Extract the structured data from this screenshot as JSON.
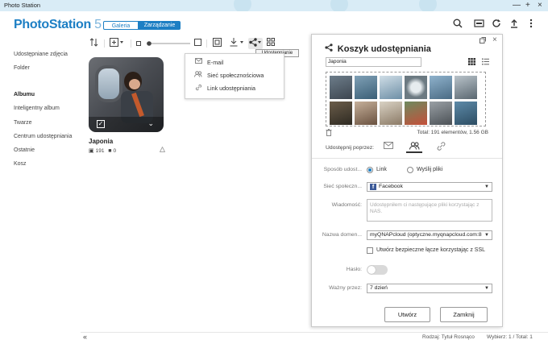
{
  "window": {
    "title": "Photo Station",
    "controls": [
      "—",
      "+",
      "×"
    ]
  },
  "header": {
    "logo_main": "PhotoStation",
    "logo_version": " 5",
    "mode_gallery": "Galeria",
    "mode_manage": "Zarządzanie"
  },
  "sidebar": {
    "items": [
      {
        "label": "Udostępniane zdjęcia"
      },
      {
        "label": "Folder"
      },
      {
        "label": "Albumu"
      },
      {
        "label": "Inteligentny album"
      },
      {
        "label": "Twarze"
      },
      {
        "label": "Centrum udostępniania"
      },
      {
        "label": "Ostatnie"
      },
      {
        "label": "Kosz"
      }
    ]
  },
  "toolbar": {
    "tooltip": "Udostępnianie"
  },
  "share_menu": {
    "items": [
      {
        "label": "E-mail",
        "icon": "envelope-icon"
      },
      {
        "label": "Sieć społecznościowa",
        "icon": "people-icon"
      },
      {
        "label": "Link udostępniania",
        "icon": "link-icon"
      }
    ]
  },
  "album": {
    "title": "Japonia",
    "photo_count": "191",
    "video_count": "0"
  },
  "panel": {
    "title": "Koszyk udostępniania",
    "album_name": "Japonia",
    "total": "Total: 191 elementów, 1.56 GB",
    "share_via_label": "Udostępnij poprzez:",
    "method_label": "Sposób udost...",
    "method_link": "Link",
    "method_send": "Wyślij pliki",
    "network_label": "Sieć społeczn...",
    "network_value": "Facebook",
    "message_label": "Wiadomość:",
    "message_placeholder": "Udostępniłem ci następujące pliki korzystając z NAS.",
    "domain_label": "Nazwa domen...",
    "domain_value": "myQNAPcloud (optyczne.myqnapcloud.com:8",
    "secure_link": "Utwórz bezpieczne łącze korzystając z SSL",
    "password_label": "Hasło:",
    "valid_label": "Ważny przez:",
    "valid_value": "7 dzień",
    "create_button": "Utwórz",
    "close_button": "Zamknij"
  },
  "footer": {
    "sort": "Rodzaj: Tytuł Rosnąco",
    "selected": "Wybierz: 1 / Total: 1"
  },
  "colors": {
    "accent": "#1d7fc4",
    "facebook": "#3b5998"
  }
}
